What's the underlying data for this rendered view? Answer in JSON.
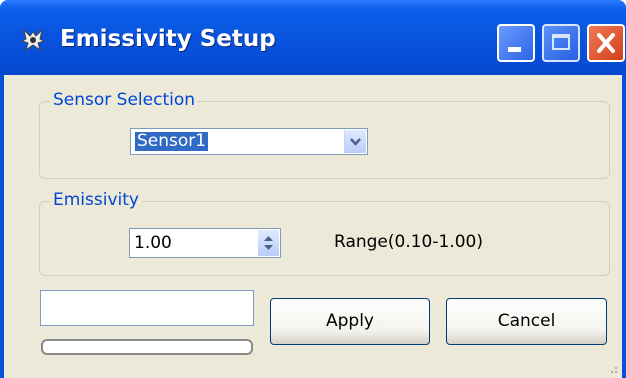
{
  "window": {
    "title": "Emissivity Setup",
    "icon": "app-emblem-icon",
    "controls": {
      "minimize": "minimize-icon",
      "maximize": "maximize-icon",
      "close": "close-icon"
    }
  },
  "sensor_group": {
    "legend": "Sensor Selection",
    "selected": "Sensor1",
    "dropdown_icon": "chevron-down-icon"
  },
  "emissivity_group": {
    "legend": "Emissivity",
    "value": "1.00",
    "range_text": "Range(0.10-1.00)",
    "spinner_icon": "up-down-arrows-icon"
  },
  "status": {
    "text": "",
    "progress": 0
  },
  "buttons": {
    "apply": "Apply",
    "cancel": "Cancel"
  },
  "colors": {
    "title_bar": "#0852dd",
    "group_legend": "#0046d5",
    "selection": "#316ac5",
    "client_bg": "#ece9d8",
    "close_button": "#d0401a"
  }
}
